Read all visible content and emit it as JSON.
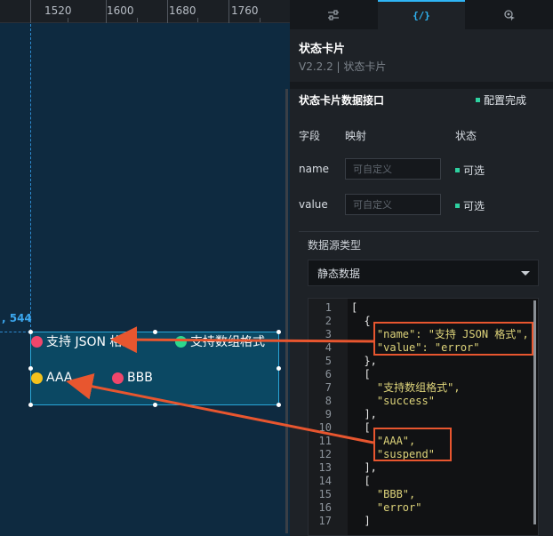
{
  "ruler": {
    "ticks": [
      "1520",
      "1600",
      "1680",
      "1760"
    ]
  },
  "canvas": {
    "coord_label": ", 544",
    "widget": {
      "items": [
        {
          "label": "支持 JSON 格式",
          "color": "#f0466b"
        },
        {
          "label": "支持数组格式",
          "color": "#2ed88d"
        },
        {
          "label": "AAA",
          "color": "#f3c21c"
        },
        {
          "label": "BBB",
          "color": "#f0466b"
        }
      ]
    }
  },
  "panel": {
    "tabs": [
      {
        "name": "tab-config",
        "icon": "sliders-icon"
      },
      {
        "name": "tab-data",
        "icon": "code-brackets-icon",
        "label": "{/}"
      },
      {
        "name": "tab-interaction",
        "icon": "cursor-gear-icon"
      }
    ],
    "title": "状态卡片",
    "version": "V2.2.2 | 状态卡片",
    "api": {
      "title": "状态卡片数据接口",
      "status": "配置完成",
      "headers": {
        "field": "字段",
        "mapping": "映射",
        "state": "状态"
      },
      "fields": [
        {
          "name": "name",
          "placeholder": "可自定义",
          "state": "可选"
        },
        {
          "name": "value",
          "placeholder": "可自定义",
          "state": "可选"
        }
      ]
    },
    "datasource": {
      "label": "数据源类型",
      "selected": "静态数据"
    },
    "code": {
      "line_numbers": [
        "1",
        "2",
        "3",
        "4",
        "5",
        "6",
        "7",
        "8",
        "9",
        "10",
        "11",
        "12",
        "13",
        "14",
        "15",
        "16",
        "17"
      ],
      "lines": [
        "[",
        "  {",
        "    \"name\": \"支持 JSON 格式\",",
        "    \"value\": \"error\"",
        "  },",
        "  [",
        "    \"支持数组格式\",",
        "    \"success\"",
        "  ],",
        "  [",
        "    \"AAA\",",
        "    \"suspend\"",
        "  ],",
        "  [",
        "    \"BBB\",",
        "    \"error\"",
        "  ]"
      ]
    }
  },
  "colors": {
    "accent": "#2fb5f5",
    "annotation": "#e8562f",
    "status_ok": "#2ed1a0"
  }
}
